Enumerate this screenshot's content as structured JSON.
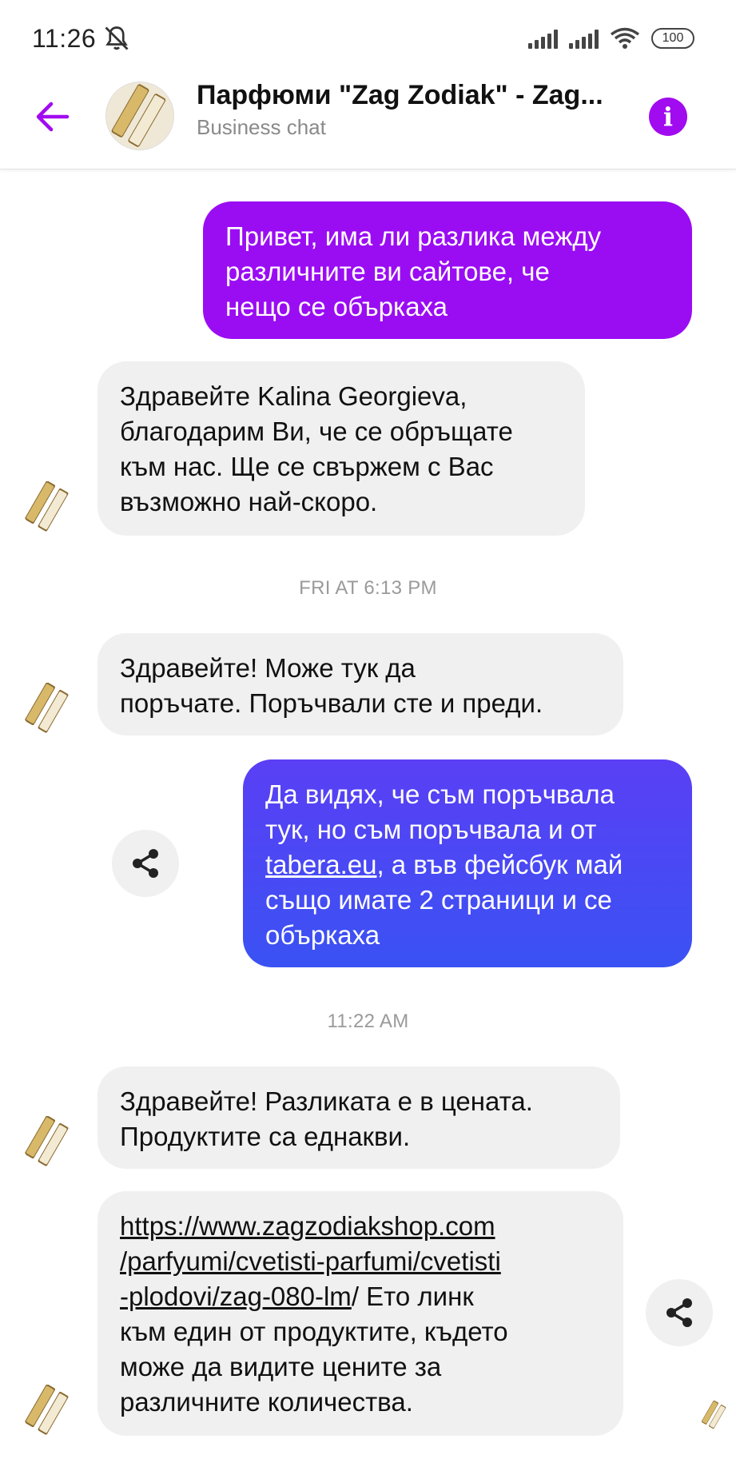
{
  "status_bar": {
    "time": "11:26",
    "battery": "100"
  },
  "header": {
    "title": "Парфюми \"Zag Zodiak\" - Zag...",
    "subtitle": "Business chat"
  },
  "colors": {
    "accent": "#a10bf0",
    "out_bubble_1": "#9a0df3",
    "out_bubble_2_top": "#5a3ff5",
    "out_bubble_2_bottom": "#3a52f3",
    "in_bubble": "#f0f0f0"
  },
  "messages": [
    {
      "direction": "out",
      "lines": [
        "Привет, има ли разлика между",
        "различните ви сайтове, че",
        "нещо се объркаха"
      ]
    },
    {
      "direction": "in",
      "lines": [
        "Здравейте Kalina Georgieva,",
        "благодарим Ви, че се обръщате",
        "към нас. Ще се свържем с Вас",
        "възможно най-скоро."
      ]
    },
    {
      "direction": "in",
      "lines": [
        "Здравейте!  Може  тук да",
        "поръчате. Поръчвали сте и преди."
      ]
    },
    {
      "direction": "out",
      "line1": "Да видях, че съм поръчвала",
      "line2": "тук, но съм поръчвала и от",
      "link": "tabera.eu",
      "line3_rest": ", а във фейсбук май",
      "line4": "също имате 2 страници и се",
      "line5": "объркаха"
    },
    {
      "direction": "in",
      "lines": [
        "Здравейте!  Разликата е в цената.",
        "Продуктите са еднакви."
      ]
    },
    {
      "direction": "in",
      "link_line1": "https://www.zagzodiakshop.com",
      "link_line2": "/parfyumi/cvetisti-parfumi/cvetisti",
      "link_line3": "-plodovi/zag-080-lm",
      "line3_rest": "/   Ето линк",
      "line4": "към един от продуктите, където",
      "line5": "може да видите  цените за",
      "line6": "различните количества."
    }
  ],
  "timestamps": {
    "t1": "FRI AT 6:13 PM",
    "t2": "11:22 AM"
  },
  "icons": {
    "back": "arrow-left-icon",
    "info": "info-icon",
    "share": "share-icon",
    "mute": "bell-off-icon",
    "wifi": "wifi-icon",
    "signal": "signal-icon",
    "battery": "battery-icon",
    "avatar": "perfume-bottles-avatar"
  }
}
